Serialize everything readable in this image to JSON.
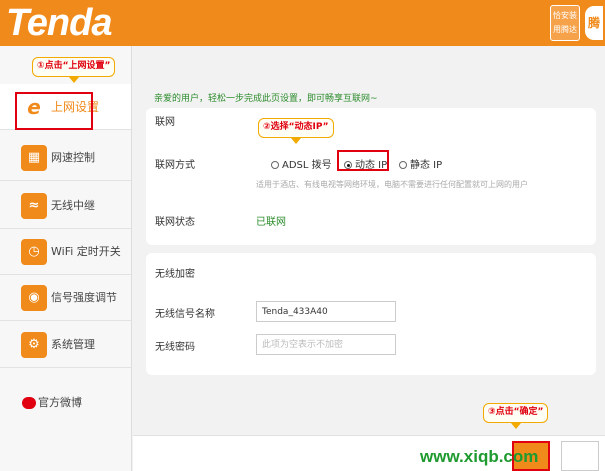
{
  "header": {
    "logo": "Tenda",
    "app_badge": [
      "恰安装",
      "用腾达"
    ]
  },
  "sidebar": {
    "items": [
      {
        "label": "上网设置",
        "icon": "e-icon"
      },
      {
        "label": "网速控制",
        "icon": "speed-icon"
      },
      {
        "label": "无线中继",
        "icon": "relay-icon"
      },
      {
        "label": "WiFi 定时开关",
        "icon": "timer-icon"
      },
      {
        "label": "信号强度调节",
        "icon": "signal-icon"
      },
      {
        "label": "系统管理",
        "icon": "gear-icon"
      }
    ],
    "weibo": "官方微博"
  },
  "callouts": {
    "step1": "①点击“上网设置”",
    "step2": "②选择“动态IP”",
    "step3": "③点击“确定”"
  },
  "main": {
    "intro": "亲爱的用户，轻松一步完成此页设置，即可畅享互联网~",
    "network": {
      "title": "联网",
      "method_label": "联网方式",
      "options": [
        "ADSL 拨号",
        "动态 IP",
        "静态 IP"
      ],
      "selected": "动态 IP",
      "description": "适用于酒店、有线电视等网络环境，电脑不需要进行任何配置就可上网的用户",
      "status_label": "联网状态",
      "status_value": "已联网"
    },
    "wireless": {
      "title": "无线加密",
      "ssid_label": "无线信号名称",
      "ssid_value": "Tenda_433A40",
      "password_label": "无线密码",
      "password_placeholder": "此项为空表示不加密"
    }
  },
  "watermark": "www.xiqb.com",
  "colors": {
    "brand": "#f08a1a",
    "highlight": "#e0000f",
    "ok_green": "#2c8c2c"
  }
}
